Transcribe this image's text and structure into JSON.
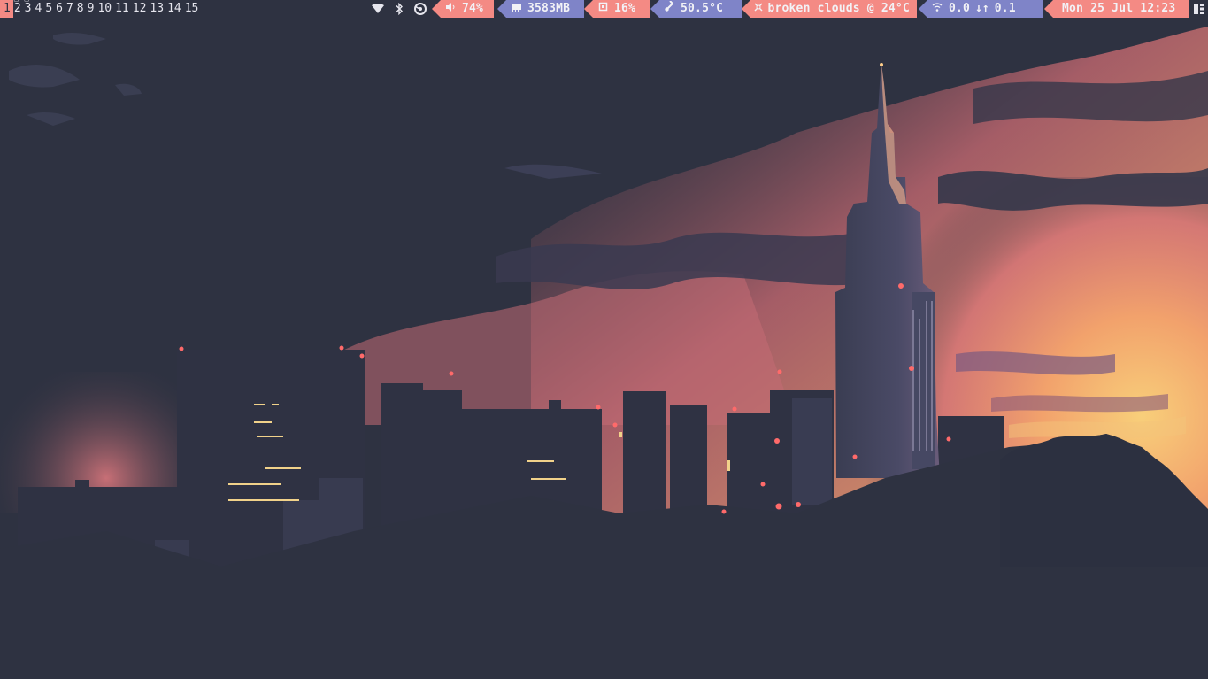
{
  "bar": {
    "workspaces": [
      "1",
      "2",
      "3",
      "4",
      "5",
      "6",
      "7",
      "8",
      "9",
      "10",
      "11",
      "12",
      "13",
      "14",
      "15"
    ],
    "active_workspace": "1",
    "occupied_marker": "□",
    "volume": "74%",
    "memory": "3583MB",
    "cpu": "16%",
    "temperature": "50.5°C",
    "weather": "broken clouds @ 24°C",
    "net_down": "0.0",
    "net_up": "0.1",
    "clock": "Mon 25 Jul 12:23"
  },
  "colors": {
    "bar_bg": "#2e3241",
    "segment_pink": "#f48a84",
    "segment_blue": "#7f84c8",
    "text_light": "#f2f2f6",
    "sky_dark": "#2e3241",
    "sky_pink": "#e07a7a",
    "sky_orange": "#f3b36c"
  },
  "icons": {
    "tray": [
      "wifi-icon",
      "bluetooth-icon",
      "steam-icon"
    ],
    "segments": [
      "volume-icon",
      "memory-icon",
      "cpu-icon",
      "temperature-icon",
      "weather-icon",
      "network-icon",
      "clock"
    ]
  }
}
